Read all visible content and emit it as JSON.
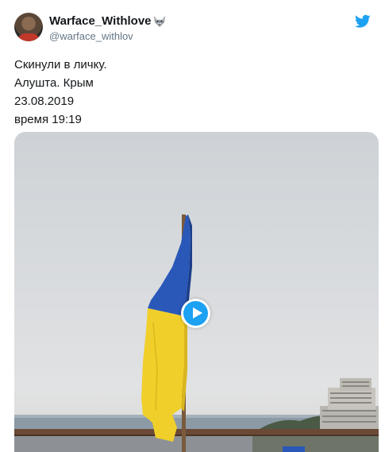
{
  "user": {
    "display_name": "Warface_Withlove",
    "handle": "@warface_withlov"
  },
  "icons": {
    "avatar": "user-avatar",
    "wolf_emoji": "wolf-face-icon",
    "platform": "twitter-bird-icon",
    "play": "play-icon"
  },
  "tweet": {
    "lines": [
      "Скинули в личку.",
      "Алушта. Крым",
      "23.08.2019",
      "время 19:19"
    ]
  },
  "colors": {
    "brand": "#1da1f2",
    "flag_blue": "#2a58b8",
    "flag_yellow": "#f1cf2a",
    "text": "#14171a",
    "muted": "#657786"
  }
}
